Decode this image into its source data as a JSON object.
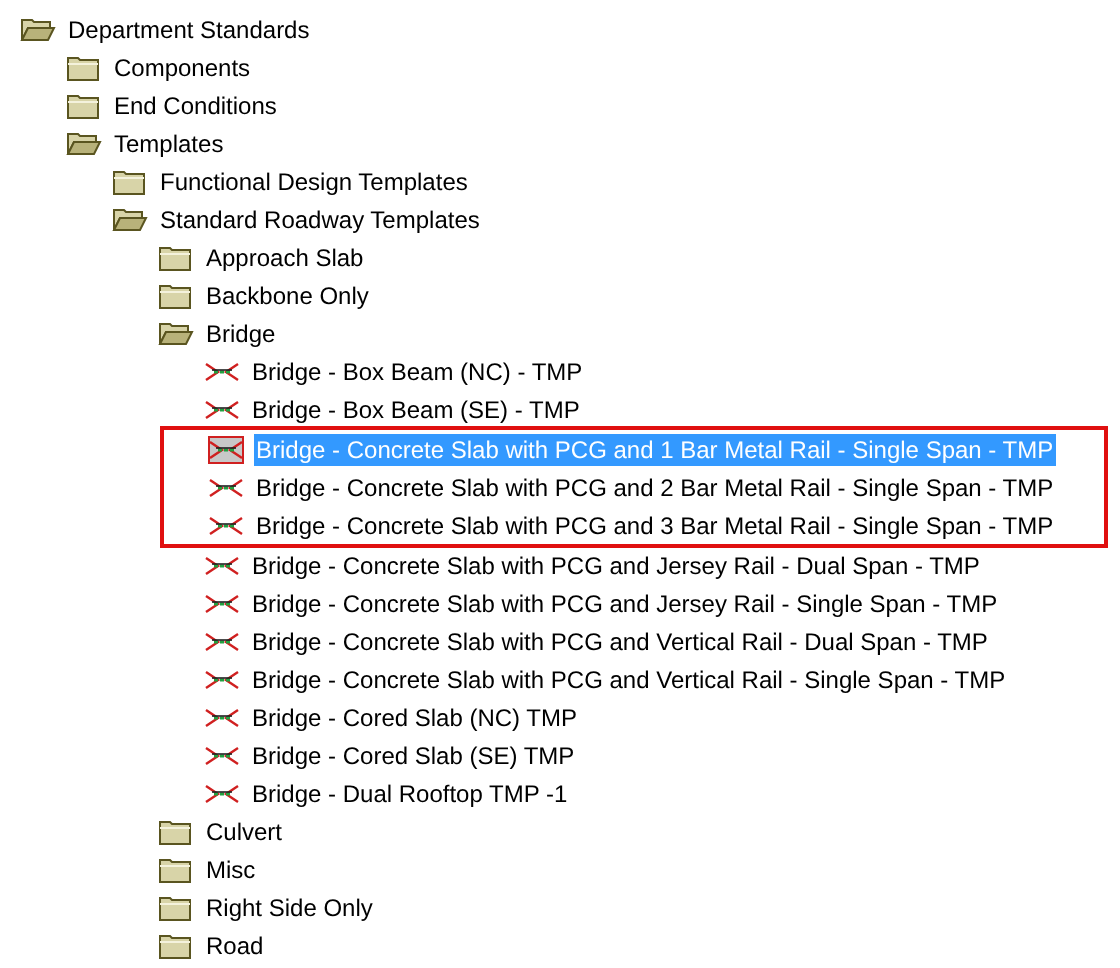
{
  "tree": [
    {
      "kind": "folder",
      "label": "Department Standards",
      "expanded": true,
      "children": [
        {
          "kind": "folder",
          "label": "Components",
          "expanded": false
        },
        {
          "kind": "folder",
          "label": "End Conditions",
          "expanded": false
        },
        {
          "kind": "folder",
          "label": "Templates",
          "expanded": true,
          "children": [
            {
              "kind": "folder",
              "label": "Functional Design Templates",
              "expanded": false
            },
            {
              "kind": "folder",
              "label": "Standard Roadway Templates",
              "expanded": true,
              "children": [
                {
                  "kind": "folder",
                  "label": "Approach Slab",
                  "expanded": false
                },
                {
                  "kind": "folder",
                  "label": "Backbone Only",
                  "expanded": false
                },
                {
                  "kind": "folder",
                  "label": "Bridge",
                  "expanded": true,
                  "children": [
                    {
                      "kind": "template",
                      "label": "Bridge - Box Beam (NC) - TMP",
                      "selected": false,
                      "annotated": false
                    },
                    {
                      "kind": "template",
                      "label": "Bridge - Box Beam (SE) - TMP",
                      "selected": false,
                      "annotated": false
                    },
                    {
                      "kind": "template",
                      "label": "Bridge - Concrete Slab with PCG and 1 Bar Metal Rail - Single Span - TMP",
                      "selected": true,
                      "annotated": true
                    },
                    {
                      "kind": "template",
                      "label": "Bridge - Concrete Slab with PCG and 2 Bar Metal Rail - Single Span - TMP",
                      "selected": false,
                      "annotated": true
                    },
                    {
                      "kind": "template",
                      "label": "Bridge - Concrete Slab with PCG and 3 Bar Metal Rail - Single Span - TMP",
                      "selected": false,
                      "annotated": true
                    },
                    {
                      "kind": "template",
                      "label": "Bridge - Concrete Slab with PCG and Jersey Rail - Dual Span - TMP",
                      "selected": false,
                      "annotated": false
                    },
                    {
                      "kind": "template",
                      "label": "Bridge - Concrete Slab with PCG and Jersey Rail - Single Span - TMP",
                      "selected": false,
                      "annotated": false
                    },
                    {
                      "kind": "template",
                      "label": "Bridge - Concrete Slab with PCG and Vertical Rail - Dual Span - TMP",
                      "selected": false,
                      "annotated": false
                    },
                    {
                      "kind": "template",
                      "label": "Bridge - Concrete Slab with PCG and Vertical Rail - Single Span - TMP",
                      "selected": false,
                      "annotated": false
                    },
                    {
                      "kind": "template",
                      "label": "Bridge - Cored Slab (NC) TMP",
                      "selected": false,
                      "annotated": false
                    },
                    {
                      "kind": "template",
                      "label": "Bridge - Cored Slab (SE) TMP",
                      "selected": false,
                      "annotated": false
                    },
                    {
                      "kind": "template",
                      "label": "Bridge - Dual Rooftop TMP -1",
                      "selected": false,
                      "annotated": false
                    }
                  ]
                },
                {
                  "kind": "folder",
                  "label": "Culvert",
                  "expanded": false
                },
                {
                  "kind": "folder",
                  "label": "Misc",
                  "expanded": false
                },
                {
                  "kind": "folder",
                  "label": "Right Side Only",
                  "expanded": false
                },
                {
                  "kind": "folder",
                  "label": "Road",
                  "expanded": false
                }
              ]
            }
          ]
        }
      ]
    }
  ]
}
